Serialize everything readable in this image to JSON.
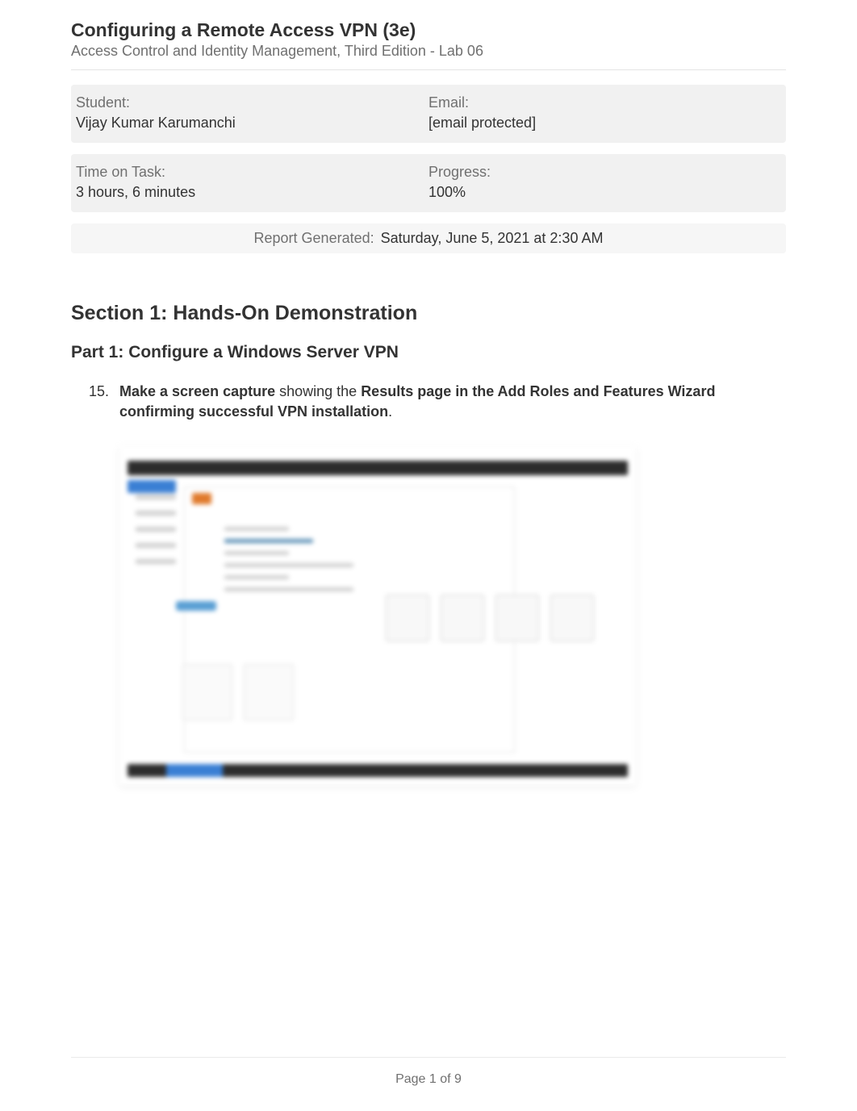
{
  "header": {
    "title": "Configuring a Remote Access VPN (3e)",
    "subtitle": "Access Control and Identity Management, Third Edition - Lab 06"
  },
  "info": {
    "student_label": "Student:",
    "student_value": "Vijay Kumar Karumanchi",
    "email_label": "Email:",
    "email_value": "[email protected]",
    "time_label": "Time on Task:",
    "time_value": "3 hours, 6 minutes",
    "progress_label": "Progress:",
    "progress_value": "100%"
  },
  "report": {
    "label": "Report Generated:",
    "value": "Saturday, June 5, 2021 at 2:30 AM"
  },
  "section": {
    "title": "Section 1: Hands-On Demonstration",
    "part_title": "Part 1: Configure a Windows Server VPN"
  },
  "step": {
    "number": "15.",
    "lead_bold": "Make a screen capture",
    "mid_plain": " showing the ",
    "trail_bold": "Results page in the Add Roles and Features Wizard confirming successful VPN installation",
    "period": "."
  },
  "footer": {
    "page": "Page 1 of 9"
  }
}
